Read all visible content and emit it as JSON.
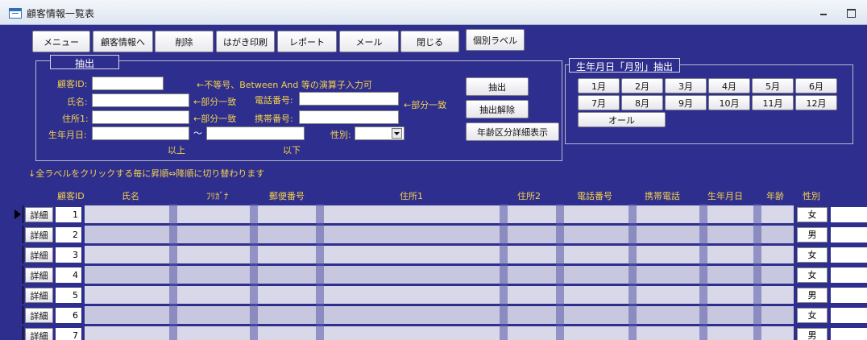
{
  "window": {
    "title": "顧客情報一覧表"
  },
  "toolbar": {
    "buttons": [
      "メニュー",
      "顧客情報へ",
      "削除",
      "はがき印刷",
      "レポート",
      "メール",
      "閉じる",
      "個別ラベル"
    ]
  },
  "extract": {
    "legend": "抽出",
    "labels": {
      "customer_id": "顧客ID:",
      "name": "氏名:",
      "address1": "住所1:",
      "birthdate": "生年月日:",
      "phone": "電話番号:",
      "mobile": "携帯番号:",
      "gender": "性別:",
      "from": "以上",
      "to": "以下",
      "tilde": "〜"
    },
    "hints": {
      "id": "←不等号、Between And 等の演算子入力可",
      "name": "←部分一致",
      "phone": "←部分一致",
      "address": "←部分一致"
    },
    "inputs": {
      "customer_id": "",
      "name": "",
      "address1": "",
      "birth_from": "",
      "birth_to": "",
      "phone": "",
      "mobile": "",
      "gender": ""
    },
    "buttons": {
      "extract": "抽出",
      "clear": "抽出解除",
      "age_detail": "年齢区分詳細表示"
    }
  },
  "month_extract": {
    "legend": "生年月日「月別」抽出",
    "months": [
      "1月",
      "2月",
      "3月",
      "4月",
      "5月",
      "6月",
      "7月",
      "8月",
      "9月",
      "10月",
      "11月",
      "12月"
    ],
    "all": "オール"
  },
  "sort_note": "↓全ラベルをクリックする毎に昇順⇔降順に切り替わります",
  "table": {
    "columns": [
      "顧客ID",
      "氏名",
      "ﾌﾘｶﾞﾅ",
      "郵便番号",
      "住所1",
      "住所2",
      "電話番号",
      "携帯電話",
      "生年月日",
      "年齢",
      "性別"
    ],
    "detail_label": "詳細",
    "rows": [
      {
        "id": "1",
        "gender": "女",
        "selected": true
      },
      {
        "id": "2",
        "gender": "男",
        "selected": false
      },
      {
        "id": "3",
        "gender": "女",
        "selected": false
      },
      {
        "id": "4",
        "gender": "女",
        "selected": false
      },
      {
        "id": "5",
        "gender": "男",
        "selected": false
      },
      {
        "id": "6",
        "gender": "女",
        "selected": false
      },
      {
        "id": "7",
        "gender": "男",
        "selected": false
      }
    ]
  },
  "colors": {
    "background": "#2e2e8e",
    "label": "#f3d24d",
    "text_light": "#ffffff"
  }
}
